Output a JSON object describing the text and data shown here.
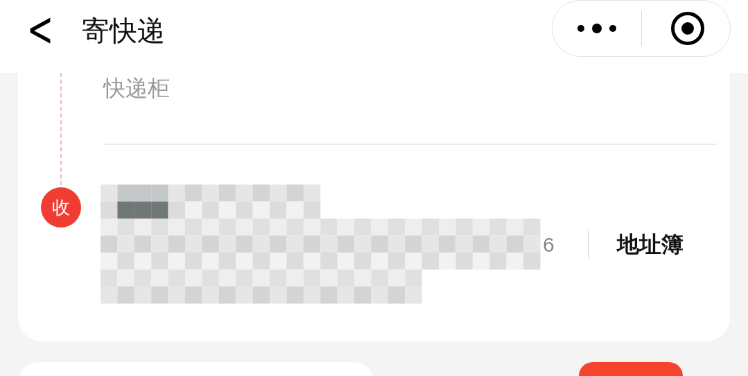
{
  "header": {
    "back": "<",
    "title": "寄快递"
  },
  "sender": {
    "pickup_method": "快递柜"
  },
  "recipient": {
    "badge": "收",
    "phone_tail": "6",
    "address_book": "地址簿"
  }
}
